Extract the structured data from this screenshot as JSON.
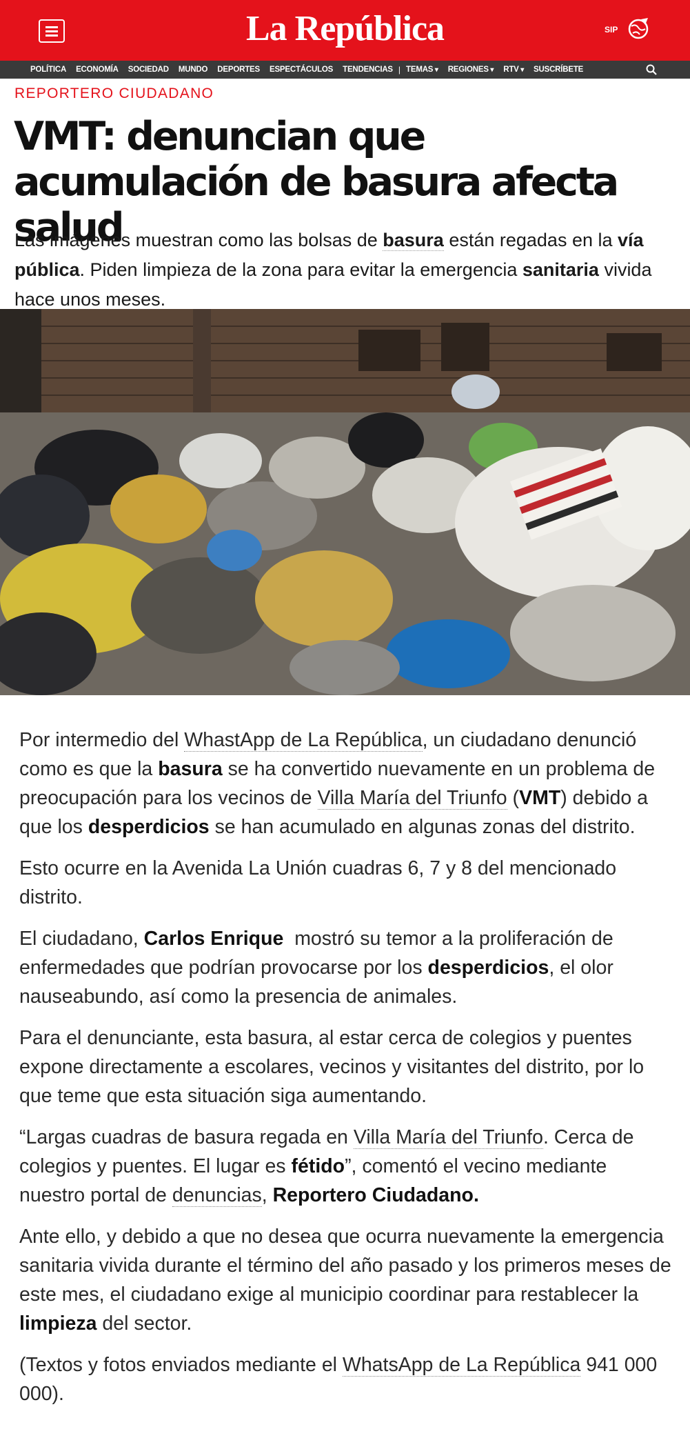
{
  "header": {
    "logo": "La República",
    "sip": "SIP",
    "menu_icon": "hamburger-icon",
    "globe_icon": "globe-pen-icon",
    "brand_color": "#e4121b"
  },
  "nav": {
    "items": [
      "POLÍTICA",
      "ECONOMÍA",
      "SOCIEDAD",
      "MUNDO",
      "DEPORTES",
      "ESPECTÁCULOS",
      "TENDENCIAS"
    ],
    "separator": "|",
    "dropdowns": [
      "TEMAS",
      "REGIONES",
      "RTV"
    ],
    "subscribe": "SUSCRÍBETE",
    "search_icon": "search-icon"
  },
  "article": {
    "section": "REPORTERO CIUDADANO",
    "title": "VMT: denuncian que acumulación de basura afecta salud",
    "subtitle": {
      "s1": "Las imágenes muestran como las bolsas de ",
      "b1": "basura",
      "s2": " están regadas en la ",
      "b2": "vía pública",
      "s3": ". Piden limpieza de la zona para evitar la emergencia ",
      "b3": "sanitaria",
      "s4": " vivida hace unos meses."
    },
    "p1": {
      "a": "Por intermedio del ",
      "link1": "WhastApp de La República",
      "b": ", un ciudadano denunció como es que la ",
      "bold1": "basura",
      "c": " se ha convertido nuevamente en un problema de preocupación para los vecinos de ",
      "link2": "Villa María del Triunfo",
      "d": " (",
      "bold2": "VMT",
      "e": ") debido a que los ",
      "bold3": "desperdicios",
      "f": " se han acumulado en algunas zonas del distrito."
    },
    "p2": "Esto ocurre en la Avenida La Unión cuadras 6, 7 y 8 del mencionado distrito.",
    "p3": {
      "a": "El ciudadano, ",
      "bold1": "Carlos Enrique",
      "b": "  mostró su temor a la proliferación de enfermedades que podrían provocarse por los ",
      "bold2": "desperdicios",
      "c": ", el olor nauseabundo, así como la presencia de animales."
    },
    "p4": "Para el denunciante, esta basura, al estar cerca de colegios y puentes expone directamente a escolares, vecinos y visitantes del distrito, por lo que teme que esta situación siga aumentando.",
    "p5": {
      "a": "“Largas cuadras de basura regada en ",
      "link1": "Villa María del Triunfo",
      "b": ". Cerca de colegios y puentes. El lugar es ",
      "bold1": "fétido",
      "c": "”, comentó el vecino mediante nuestro portal de ",
      "link2": "denuncias",
      "d": ", ",
      "bold2": "Reportero Ciudadano."
    },
    "p6": {
      "a": "Ante ello, y debido a que no desea que ocurra nuevamente la emergencia sanitaria vivida durante el término del año pasado y los primeros meses de este mes, el ciudadano exige al municipio coordinar para restablecer la ",
      "bold1": "limpieza",
      "b": " del sector."
    },
    "p7": {
      "a": "(Textos y fotos enviados mediante el ",
      "link1": "WhatsApp de La República",
      "b": " 941 000 000)."
    }
  }
}
